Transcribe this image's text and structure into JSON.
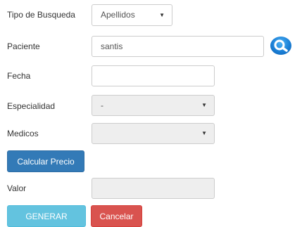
{
  "form": {
    "tipo_busqueda": {
      "label": "Tipo de Busqueda",
      "value": "Apellidos"
    },
    "paciente": {
      "label": "Paciente",
      "value": "santis"
    },
    "fecha": {
      "label": "Fecha",
      "value": ""
    },
    "especialidad": {
      "label": "Especialidad",
      "value": "-"
    },
    "medicos": {
      "label": "Medicos",
      "value": ""
    },
    "valor": {
      "label": "Valor",
      "value": ""
    }
  },
  "buttons": {
    "calcular": "Calcular Precio",
    "generar": "GENERAR",
    "cancelar": "Cancelar"
  },
  "icons": {
    "search": "search-icon",
    "caret": "caret-down-icon"
  },
  "colors": {
    "primary": "#337ab7",
    "info": "#5bc0de",
    "danger": "#d9534f",
    "search": "#1a7fd6"
  }
}
